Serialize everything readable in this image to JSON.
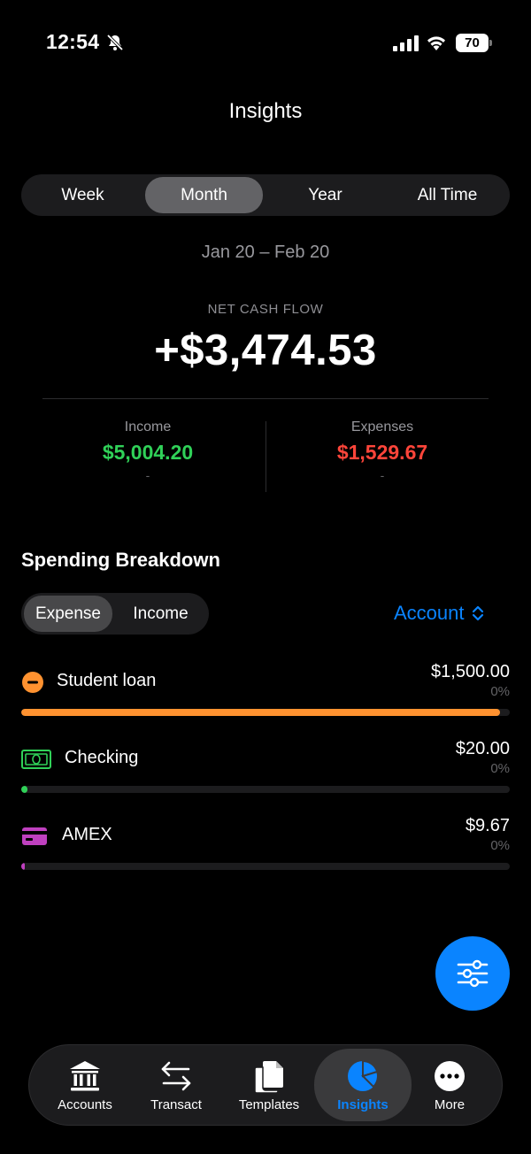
{
  "status_bar": {
    "time": "12:54",
    "battery": "70"
  },
  "header": {
    "title": "Insights"
  },
  "period": {
    "options": [
      "Week",
      "Month",
      "Year",
      "All Time"
    ],
    "selected": "Month"
  },
  "date_range": "Jan 20 – Feb 20",
  "summary": {
    "net_label": "NET CASH FLOW",
    "net_value": "+$3,474.53",
    "income_label": "Income",
    "income_value": "$5,004.20",
    "income_sub": "-",
    "expenses_label": "Expenses",
    "expenses_value": "$1,529.67",
    "expenses_sub": "-"
  },
  "breakdown": {
    "title": "Spending Breakdown",
    "type_options": [
      "Expense",
      "Income"
    ],
    "type_selected": "Expense",
    "group_by": "Account",
    "rows": [
      {
        "name": "Student loan",
        "amount": "$1,500.00",
        "percent": "0%",
        "fill": 0.98,
        "color": "#ff9230",
        "icon": "minus-circle-icon"
      },
      {
        "name": "Checking",
        "amount": "$20.00",
        "percent": "0%",
        "fill": 0.013,
        "color": "#30d158",
        "icon": "banknote-icon"
      },
      {
        "name": "AMEX",
        "amount": "$9.67",
        "percent": "0%",
        "fill": 0.006,
        "color": "#bf40bf",
        "icon": "credit-card-icon"
      }
    ]
  },
  "tab_bar": {
    "tabs": [
      {
        "label": "Accounts",
        "icon": "bank-icon"
      },
      {
        "label": "Transact",
        "icon": "transfer-arrows-icon"
      },
      {
        "label": "Templates",
        "icon": "documents-icon"
      },
      {
        "label": "Insights",
        "icon": "pie-chart-icon"
      },
      {
        "label": "More",
        "icon": "more-icon"
      }
    ],
    "active": "Insights"
  },
  "colors": {
    "accent": "#0a84ff",
    "income": "#30d158",
    "expense": "#ff453a"
  }
}
